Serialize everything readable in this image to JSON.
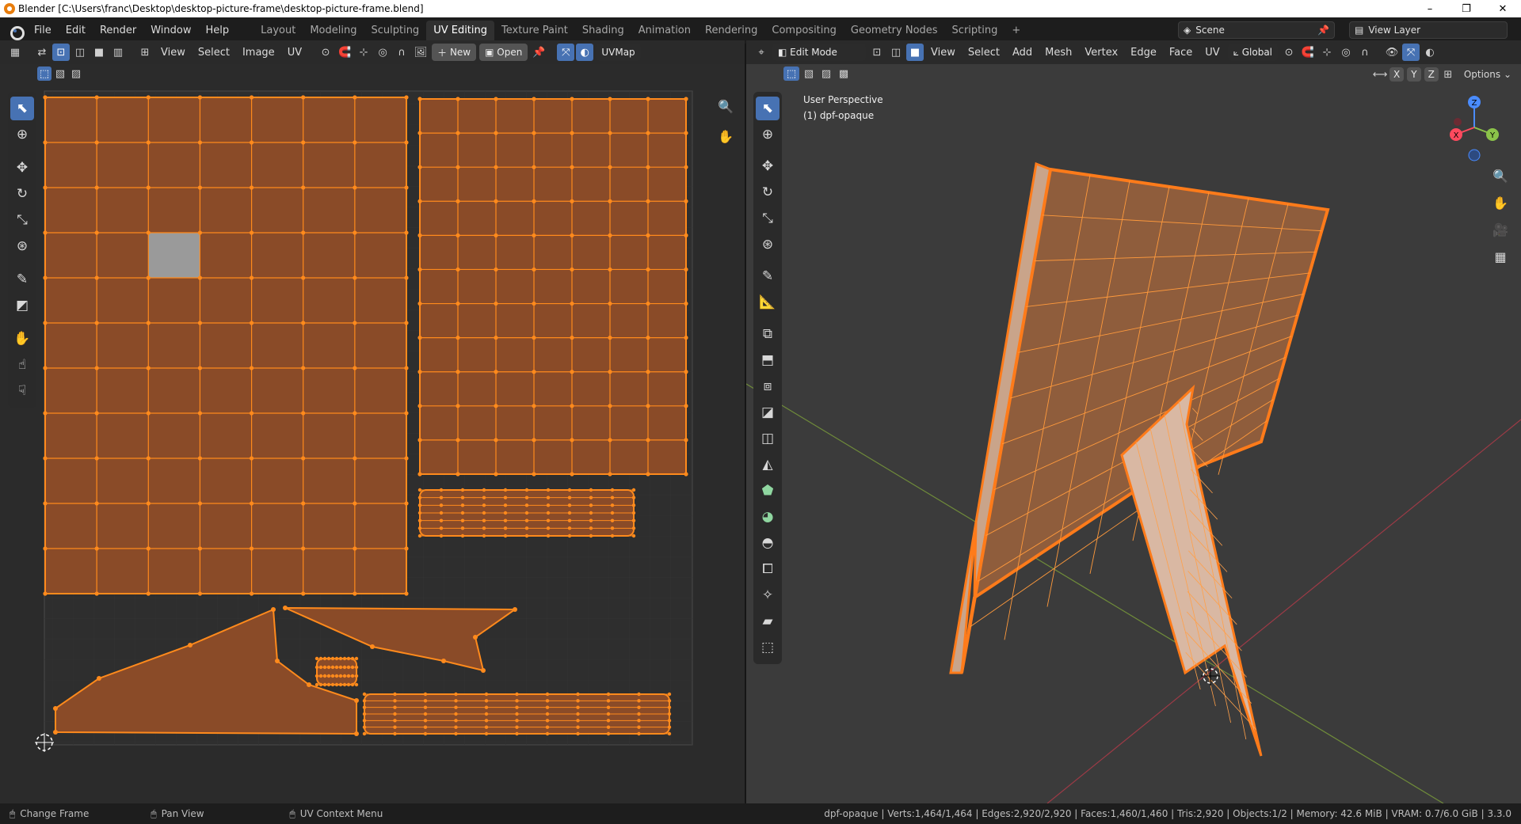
{
  "window": {
    "title": "Blender [C:\\Users\\franc\\Desktop\\desktop-picture-frame\\desktop-picture-frame.blend]",
    "minimize": "–",
    "maximize": "❐",
    "close": "✕"
  },
  "menu": [
    "File",
    "Edit",
    "Render",
    "Window",
    "Help"
  ],
  "workspaces": [
    "Layout",
    "Modeling",
    "Sculpting",
    "UV Editing",
    "Texture Paint",
    "Shading",
    "Animation",
    "Rendering",
    "Compositing",
    "Geometry Nodes",
    "Scripting"
  ],
  "active_workspace": "UV Editing",
  "add_workspace": "+",
  "scene": {
    "name": "Scene"
  },
  "view_layer": {
    "name": "View Layer"
  },
  "uv_editor": {
    "header_menus": [
      "View",
      "Select",
      "Image",
      "UV"
    ],
    "new_label": "New",
    "open_label": "Open",
    "uvmap_label": "UVMap"
  },
  "viewport": {
    "mode_label": "Edit Mode",
    "header_menus": [
      "View",
      "Select",
      "Add",
      "Mesh",
      "Vertex",
      "Edge",
      "Face",
      "UV"
    ],
    "orientation": "Global",
    "options_label": "Options",
    "axis_buttons": [
      "X",
      "Y",
      "Z"
    ],
    "view_name": "User Perspective",
    "object_label": "(1) dpf-opaque"
  },
  "gizmo": {
    "x": "X",
    "y": "Y",
    "z": "Z"
  },
  "status": {
    "hint1": "Change Frame",
    "hint2": "Pan View",
    "hint3": "UV Context Menu",
    "stats": "dpf-opaque | Verts:1,464/1,464 | Edges:2,920/2,920 | Faces:1,460/1,460 | Tris:2,920 | Objects:1/2 | Memory: 42.6 MiB | VRAM: 0.7/6.0 GiB | 3.3.0"
  },
  "colors": {
    "accent": "#4772b3",
    "uv_fill": "#8a4b28",
    "uv_edge": "#ff8a1c",
    "selected_face": "#9a9a9a"
  }
}
